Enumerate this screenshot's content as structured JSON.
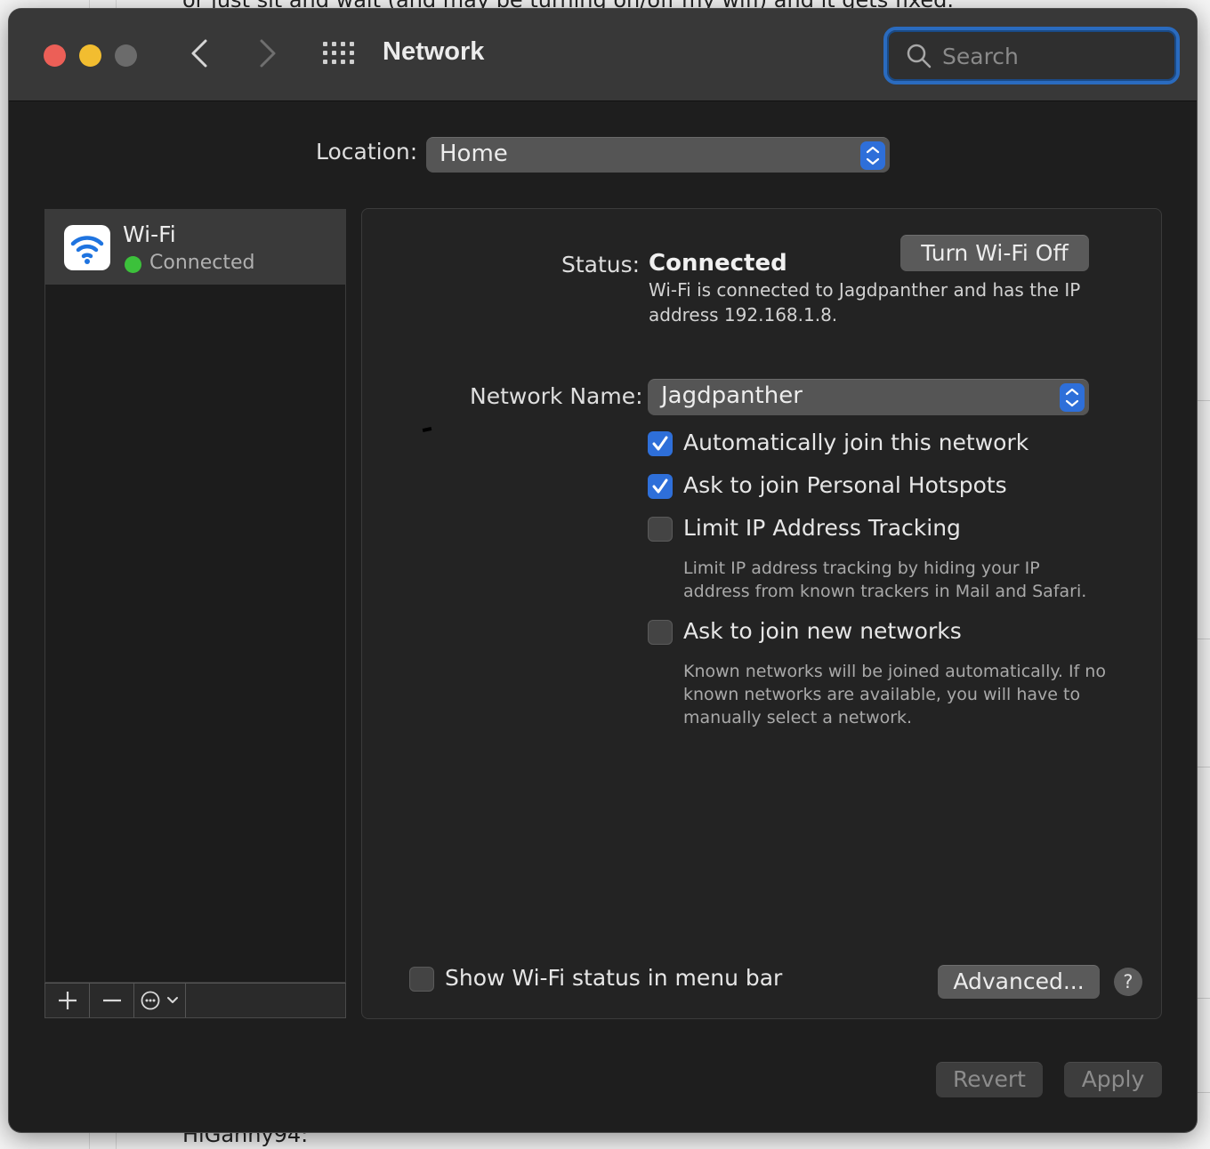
{
  "background_page": {
    "top_text": "or just sit and wait (and may be turning on/off my wifi) and it gets fixed.",
    "bottom_text": "HiGanny94:"
  },
  "window": {
    "title": "Network",
    "search_placeholder": "Search"
  },
  "location": {
    "label": "Location:",
    "value": "Home"
  },
  "sidebar": {
    "services": [
      {
        "name": "Wi-Fi",
        "status": "Connected",
        "status_color": "#3cc13b",
        "icon": "wifi-icon"
      }
    ],
    "toolbar": {
      "add_icon": "plus-icon",
      "remove_icon": "minus-icon",
      "action_icon": "ellipsis-circle-icon"
    }
  },
  "detail": {
    "status_label": "Status:",
    "status_value": "Connected",
    "toggle_button": "Turn Wi-Fi Off",
    "status_description": "Wi-Fi is connected to Jagdpanther and has the IP address 192.168.1.8.",
    "network_name_label": "Network Name:",
    "network_name_value": "Jagdpanther",
    "options": [
      {
        "label": "Automatically join this network",
        "checked": true,
        "help": ""
      },
      {
        "label": "Ask to join Personal Hotspots",
        "checked": true,
        "help": ""
      },
      {
        "label": "Limit IP Address Tracking",
        "checked": false,
        "help": "Limit IP address tracking by hiding your IP address from known trackers in Mail and Safari."
      },
      {
        "label": "Ask to join new networks",
        "checked": false,
        "help": "Known networks will be joined automatically. If no known networks are available, you will have to manually select a network."
      }
    ],
    "show_menu_bar_label": "Show Wi-Fi status in menu bar",
    "show_menu_bar_checked": false,
    "advanced_button": "Advanced...",
    "help_button": "?"
  },
  "footer": {
    "revert_button": "Revert",
    "apply_button": "Apply"
  },
  "colors": {
    "accent": "#2e6fd9",
    "window_bg": "#1e1e1e",
    "titlebar_bg": "#383838"
  }
}
